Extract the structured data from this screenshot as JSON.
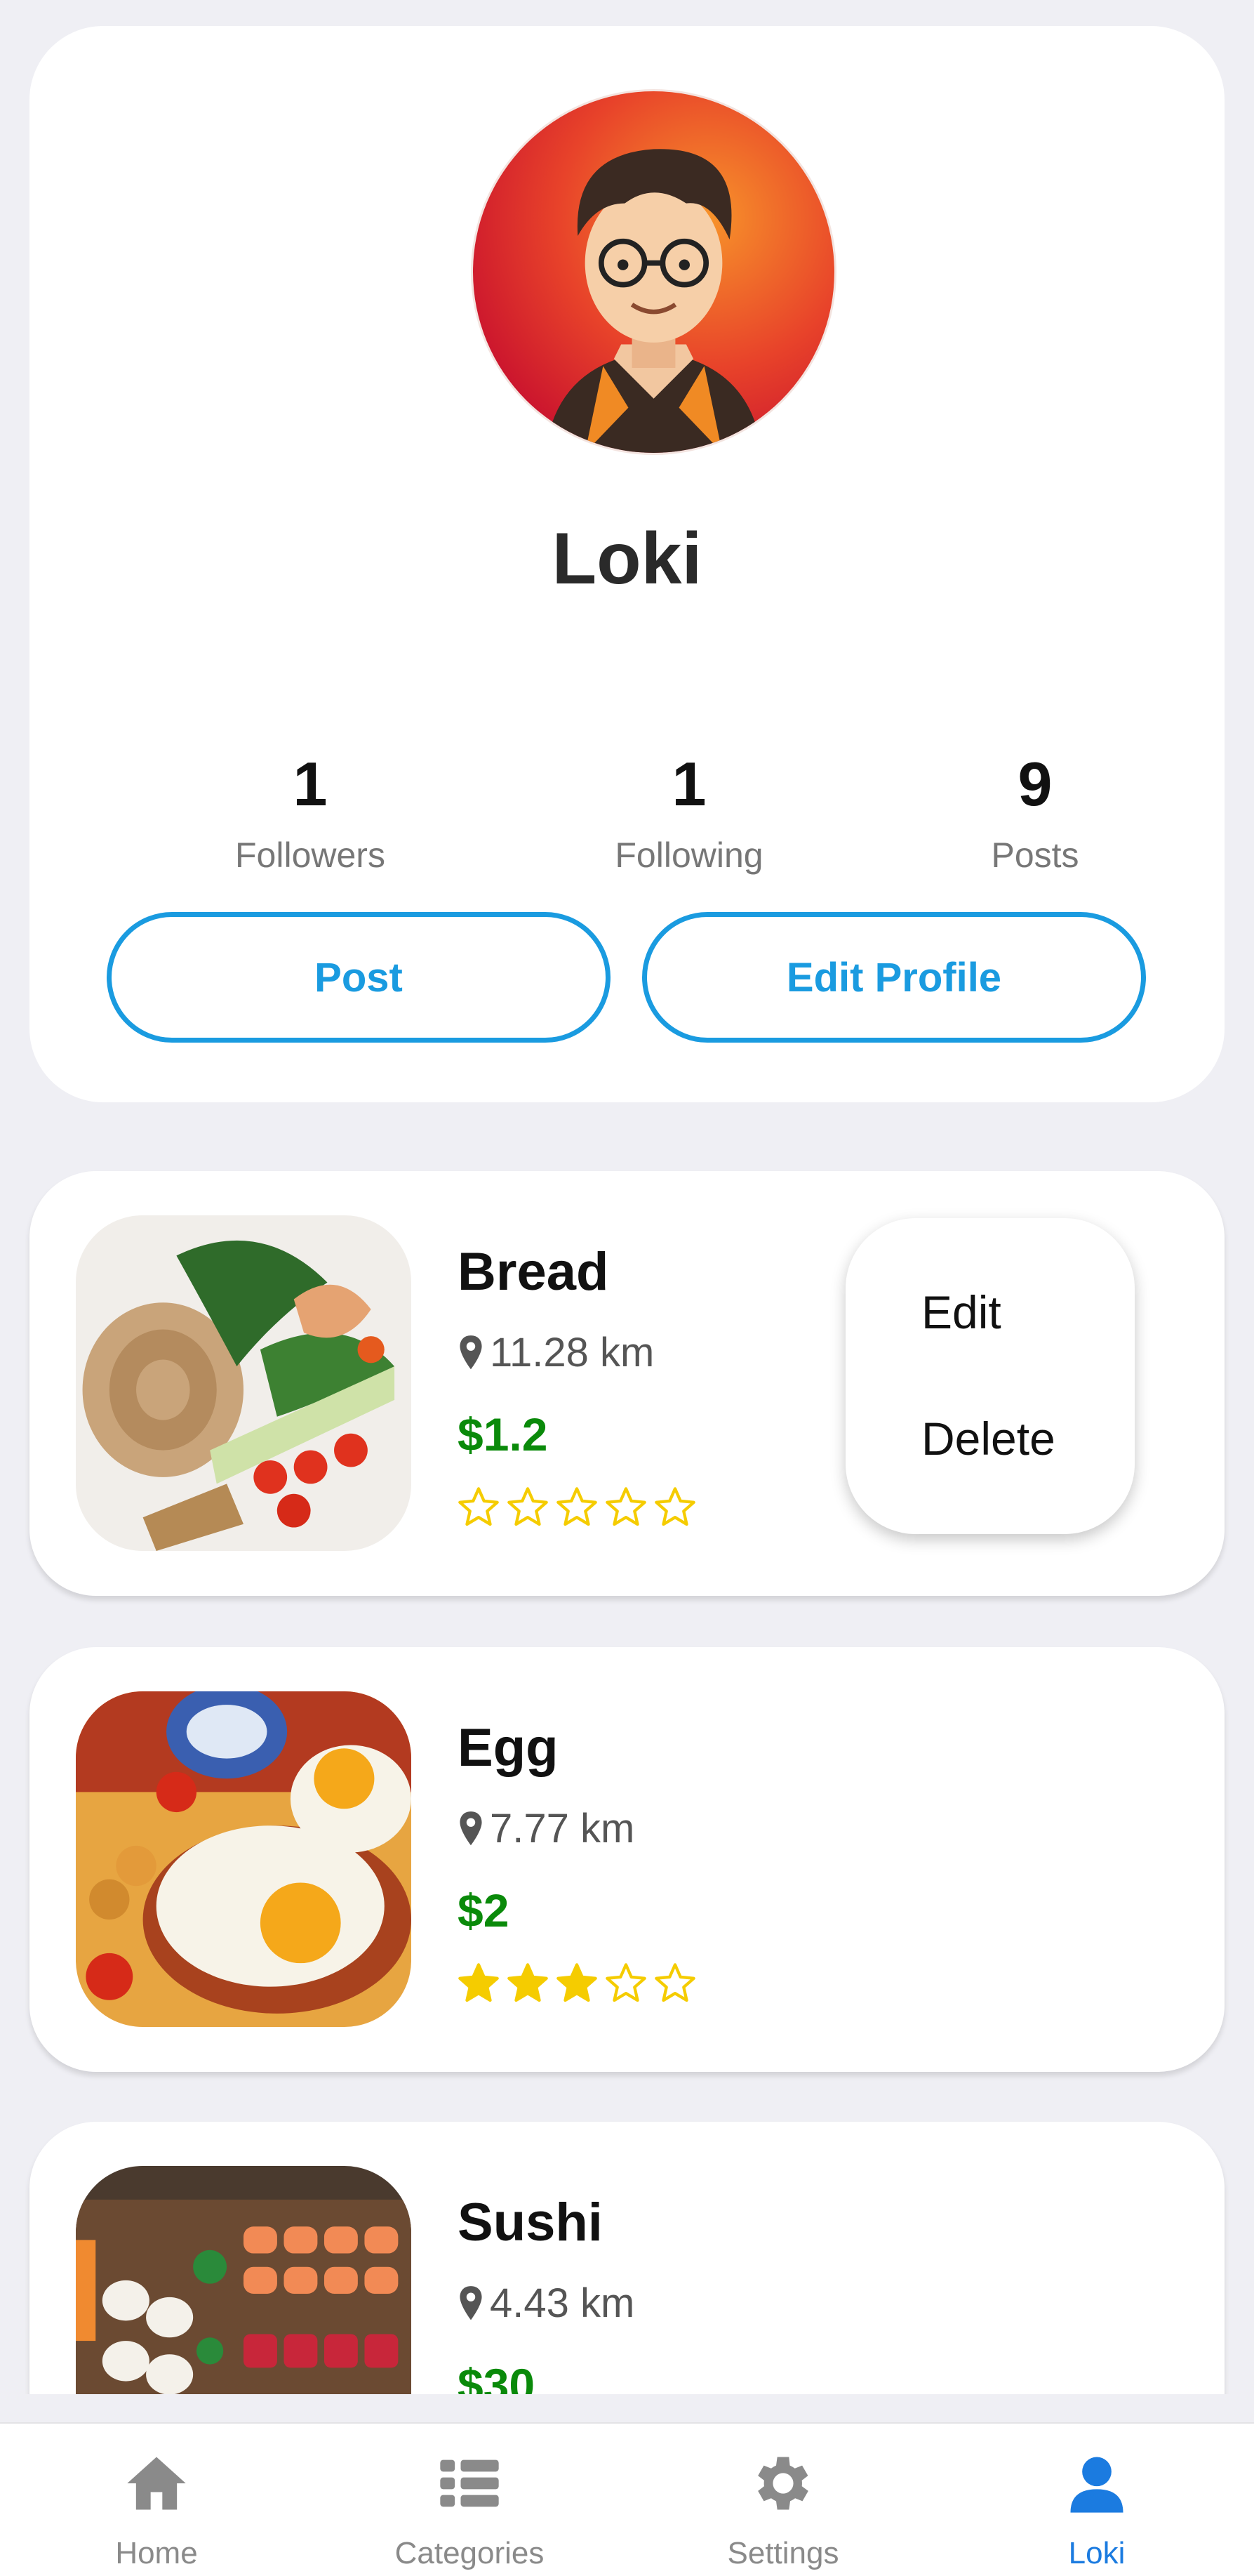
{
  "profile": {
    "name": "Loki",
    "stats": [
      {
        "value": "1",
        "label": "Followers"
      },
      {
        "value": "1",
        "label": "Following"
      },
      {
        "value": "9",
        "label": "Posts"
      }
    ],
    "post_button": "Post",
    "edit_profile_button": "Edit Profile"
  },
  "posts": [
    {
      "title": "Bread",
      "distance": "11.28 km",
      "price": "$1.2",
      "rating": 0
    },
    {
      "title": "Egg",
      "distance": "7.77 km",
      "price": "$2",
      "rating": 3
    },
    {
      "title": "Sushi",
      "distance": "4.43 km",
      "price": "$30",
      "rating": 0
    }
  ],
  "context_menu": {
    "edit": "Edit",
    "delete": "Delete"
  },
  "tabs": [
    {
      "label": "Home",
      "icon": "home-icon"
    },
    {
      "label": "Categories",
      "icon": "list-icon"
    },
    {
      "label": "Settings",
      "icon": "gear-icon"
    },
    {
      "label": "Loki",
      "icon": "user-icon",
      "active": true
    }
  ],
  "colors": {
    "accent": "#1a9be0",
    "price": "#0a8a0a",
    "star": "#f5cc00",
    "active_tab": "#1b7be0",
    "inactive_tab": "#8a8a8a"
  }
}
